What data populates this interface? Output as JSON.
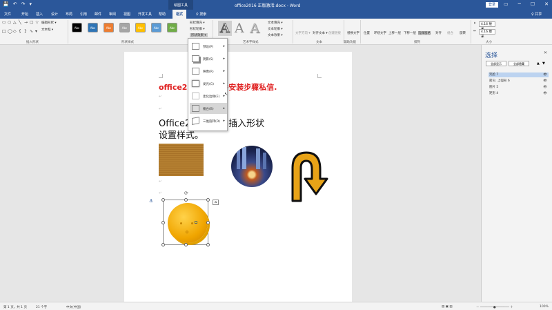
{
  "titlebar": {
    "quick_access": [
      "💾",
      "↶",
      "↷",
      "▾"
    ],
    "doc_title": "office2016 正版激活.docx - Word",
    "context_group": "绘图工具",
    "login_label": "登录",
    "controls": [
      "▭",
      "─",
      "☐",
      "✕"
    ]
  },
  "tabs": {
    "items": [
      "文件",
      "开始",
      "插入",
      "设计",
      "布局",
      "引用",
      "邮件",
      "审阅",
      "视图",
      "开发工具",
      "帮助"
    ],
    "active": "格式",
    "search": "♀ 搜索",
    "share": "♀ 共享"
  },
  "ribbon": {
    "groups": {
      "insert_shapes": "插入形状",
      "shape_styles": "形状样式",
      "wordart_styles": "艺术字样式",
      "text": "文本",
      "accessibility": "辅助功能",
      "arrange": "排列",
      "size": "大小"
    },
    "edit_shape": "编辑形状 ▾",
    "text_box": "文本框 ▾",
    "swatch_label": "Abc",
    "swatch_colors": [
      "#000000",
      "#2e75b6",
      "#ed7d31",
      "#a5a5a5",
      "#ffc000",
      "#5b9bd5",
      "#70ad47"
    ],
    "shape_fill": "形状填充 ▾",
    "shape_outline": "形状轮廓 ▾",
    "shape_effects": "形状效果 ▾",
    "text_fill": "文本填充 ▾",
    "text_outline": "文本轮廓 ▾",
    "text_effects": "文本效果 ▾",
    "wa_letter": "A",
    "text_direction": "文字方向 ▾",
    "align_text": "对齐文本 ▾",
    "create_link": "创建链接",
    "alt_text": "替换文字",
    "arrange_buttons": [
      "位置",
      "环绕文字",
      "上移一层",
      "下移一层",
      "选择窗格",
      "对齐",
      "组合",
      "旋转"
    ],
    "height_value": "4.16 厘米",
    "width_value": "4.16 厘米"
  },
  "document": {
    "line1_red": "office2016 下载并安装步骤私信.",
    "line2": "Office2016 文档插入形状",
    "line3": "设置样式。"
  },
  "effects_menu": {
    "items": [
      {
        "label": "预设(P)",
        "hover": false
      },
      {
        "label": "阴影(S)",
        "hover": false
      },
      {
        "label": "映像(R)",
        "hover": false
      },
      {
        "label": "发光(G)",
        "hover": false
      },
      {
        "label": "柔化边缘(E)",
        "hover": false
      },
      {
        "label": "棱台(B)",
        "hover": true
      },
      {
        "label": "三维旋转(D)",
        "hover": false
      }
    ],
    "arrow": "▸"
  },
  "selection_pane": {
    "title": "选择",
    "close": "✕",
    "show_all": "全部显示",
    "hide_all": "全部隐藏",
    "items": [
      {
        "label": "笑脸 7",
        "selected": true
      },
      {
        "label": "箭头: 上弧形 6",
        "selected": false
      },
      {
        "label": "图片 5",
        "selected": false
      },
      {
        "label": "矩形 4",
        "selected": false
      }
    ],
    "eye": "👁"
  },
  "statusbar": {
    "page": "第 1 页，共 1 页",
    "words": "21 个字",
    "lang": "中文(中国)",
    "zoom": "100%"
  },
  "colors": {
    "accent": "#2b579a",
    "smiley": "#f0a500",
    "arrow": "#e8a317"
  }
}
